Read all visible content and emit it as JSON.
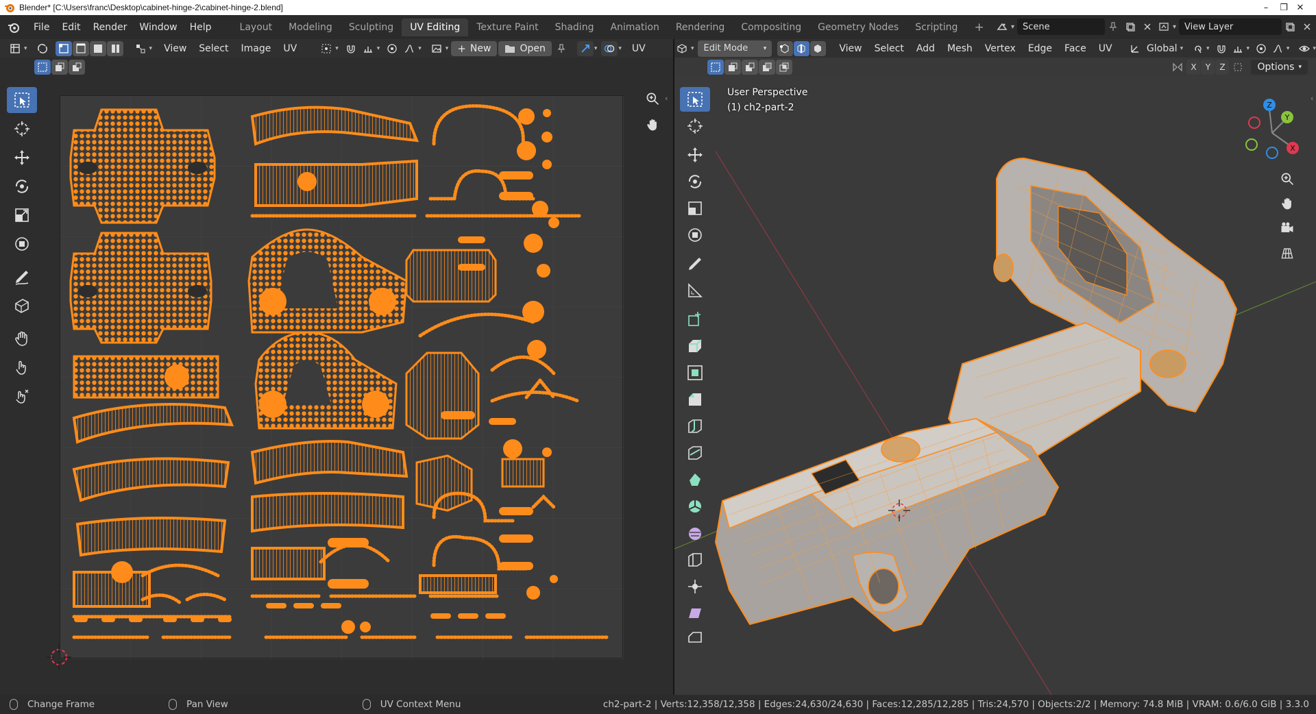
{
  "window": {
    "title": "Blender* [C:\\Users\\franc\\Desktop\\cabinet-hinge-2\\cabinet-hinge-2.blend]",
    "controls": [
      "–",
      "❐",
      "✕"
    ]
  },
  "menus": [
    "File",
    "Edit",
    "Render",
    "Window",
    "Help"
  ],
  "workspaces": {
    "tabs": [
      "Layout",
      "Modeling",
      "Sculpting",
      "UV Editing",
      "Texture Paint",
      "Shading",
      "Animation",
      "Rendering",
      "Compositing",
      "Geometry Nodes",
      "Scripting"
    ],
    "active": "UV Editing",
    "add": "+"
  },
  "scene": {
    "name": "Scene"
  },
  "view_layer": {
    "name": "View Layer"
  },
  "uv_editor": {
    "menus": [
      "View",
      "Select",
      "Image",
      "UV"
    ],
    "new_label": "New",
    "open_label": "Open",
    "truncated_label": "UV"
  },
  "viewport": {
    "mode": "Edit Mode",
    "menus": [
      "View",
      "Select",
      "Add",
      "Mesh",
      "Vertex",
      "Edge",
      "Face",
      "UV"
    ],
    "orientation": "Global",
    "axes": [
      "X",
      "Y",
      "Z"
    ],
    "options_label": "Options",
    "view_name": "User Perspective",
    "object_label": "(1) ch2-part-2",
    "gizmo_axes": [
      "Z",
      "Y",
      "X"
    ]
  },
  "statusbar": {
    "hints": [
      "Change Frame",
      "Pan View",
      "UV Context Menu"
    ],
    "stats": "ch2-part-2 | Verts:12,358/12,358 | Edges:24,630/24,630 | Faces:12,285/12,285 | Tris:24,570 | Objects:2/2 | Memory: 74.8 MiB | VRAM: 0.6/6.0 GiB | 3.3.0"
  },
  "colors": {
    "uv_orange": "#ff8c1a",
    "uv_fill": "#7a4a2a",
    "active_blue": "#4772b3",
    "axis_x": "#e0394f",
    "axis_y": "#8ac43d",
    "axis_z": "#2f8ee6"
  }
}
